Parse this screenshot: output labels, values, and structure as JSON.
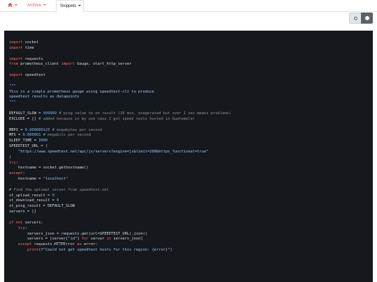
{
  "nav": {
    "tabs": [
      {
        "label": "",
        "icon": "home-icon",
        "has_caret": true
      },
      {
        "label": "Archive",
        "has_caret": true
      },
      {
        "label": "Snippets",
        "has_caret": true,
        "active": true
      }
    ]
  },
  "theme_toggle": {
    "options": [
      "light-mode-icon",
      "dark-mode-icon"
    ],
    "selected": "dark"
  },
  "colors": {
    "accent": "#e05d44",
    "code_bg": "#15181c",
    "keyword": "#ff6b6b",
    "string": "#9ecbff",
    "number": "#79b8ff",
    "comment": "#8b949e"
  },
  "code": {
    "language": "python",
    "lines": [
      "import socket",
      "import time",
      "",
      "import requests",
      "from prometheus_client import Gauge, start_http_server",
      "",
      "import speedtest",
      "",
      "\"\"\"",
      "This is a simple prometheus gauge using speedtest-cli to produce",
      "speedtest results as datapoints",
      "\"\"\"",
      "",
      "DEFAULT_SLOW = 999999 # ping value to no result (16 min, exagerated but over 1 sec means problems)",
      "EXCLUDE = [] # added because in my use case I got speed tests hosted in Guatemala!",
      "",
      "MBPS = 0.000000125 # megabytes per second",
      "MPS = 0.000001 # megabits per second",
      "SLEEP_TIME = 3000",
      "SPEEDTEST_URL = (",
      "    \"https://www.speedtest.net/api/js/servers?engine=js&limit=200&https_functional=true\"",
      ")",
      "try:",
      "    hostname = socket.gethostname()",
      "except:",
      "    hostname = \"localhost\"",
      "",
      "# Find the optimal server from speedtest.net",
      "st_upload_result = 0",
      "st_download_result = 0",
      "st_ping_result = DEFAULT_SLOW",
      "servers = []",
      "",
      "if not servers:",
      "    try:",
      "        servers_json = requests.get(url=SPEEDTEST_URL).json()",
      "        servers = [server[\"id\"] for server in servers_json]",
      "    except requests.HTTPError as error:",
      "        print(f\"Could not get speedtest hosts for this region: {error}\")"
    ]
  }
}
